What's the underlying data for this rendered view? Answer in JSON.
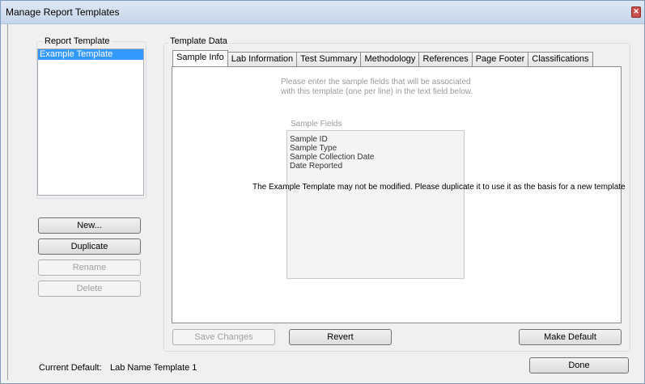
{
  "window": {
    "title": "Manage Report Templates"
  },
  "report_template": {
    "label": "Report Template",
    "items": [
      {
        "label": "Example Template",
        "selected": true
      }
    ]
  },
  "buttons": {
    "new": "New...",
    "duplicate": "Duplicate",
    "rename": "Rename",
    "delete": "Delete",
    "save_changes": "Save Changes",
    "revert": "Revert",
    "make_default": "Make Default",
    "done": "Done"
  },
  "template_data": {
    "label": "Template Data",
    "tabs": [
      {
        "label": "Sample Info",
        "active": true
      },
      {
        "label": "Lab Information"
      },
      {
        "label": "Test Summary"
      },
      {
        "label": "Methodology"
      },
      {
        "label": "References"
      },
      {
        "label": "Page Footer"
      },
      {
        "label": "Classifications"
      }
    ],
    "instructions_line1": "Please enter the sample fields that will be associated",
    "instructions_line2": "with this template (one per line) in the text field below.",
    "sample_fields_label": "Sample Fields",
    "sample_fields": [
      "Sample ID",
      "Sample Type",
      "Sample Collection Date",
      "Date Reported"
    ],
    "notice": "The Example Template may not be modified.  Please duplicate it to use it as the basis for a new template"
  },
  "status": {
    "current_default_label": "Current Default:",
    "current_default_value": "Lab Name Template 1"
  }
}
